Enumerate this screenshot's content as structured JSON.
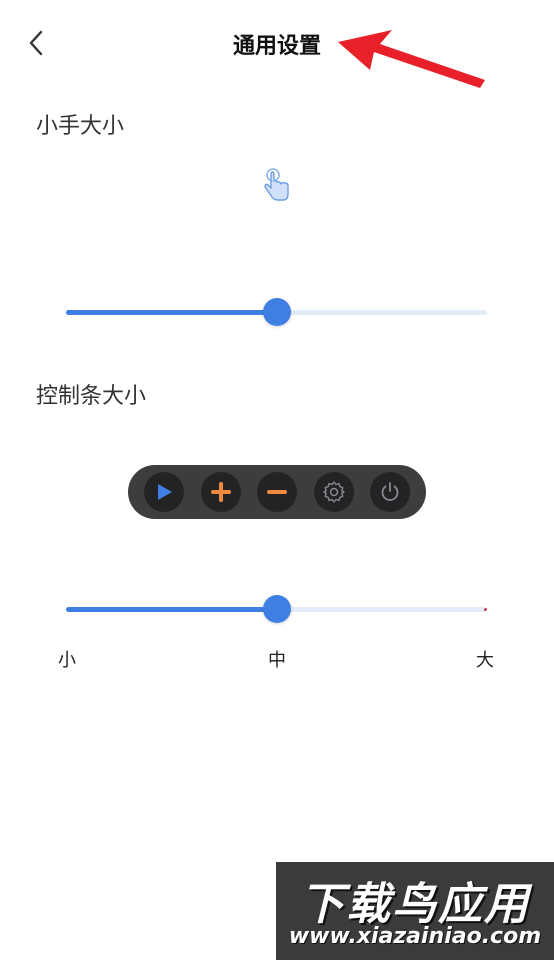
{
  "header": {
    "title": "通用设置",
    "back_icon": "chevron-left-icon"
  },
  "hand_section": {
    "label": "小手大小",
    "preview_icon": "pointer-hand-icon",
    "slider": {
      "value_percent": 50
    }
  },
  "control_bar_section": {
    "label": "控制条大小",
    "buttons": [
      {
        "icon": "play-icon"
      },
      {
        "icon": "plus-icon"
      },
      {
        "icon": "minus-icon"
      },
      {
        "icon": "gear-icon"
      },
      {
        "icon": "power-icon"
      }
    ],
    "slider": {
      "value_percent": 50
    },
    "scale_labels": {
      "small": "小",
      "medium": "中",
      "large": "大"
    }
  },
  "watermark": {
    "brand": "下载鸟应用",
    "url": "www.xiazainiao.com"
  },
  "colors": {
    "accent": "#3f7fe4",
    "track": "#e3ecf8",
    "control_bar_bg": "#3d3d3f",
    "button_bg": "#232325",
    "plus_minus": "#f08a3e",
    "annotation_arrow": "#e8202a"
  }
}
